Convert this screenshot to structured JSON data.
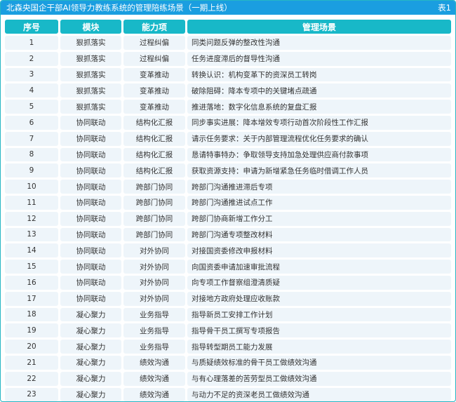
{
  "title": "北森央国企干部AI领导力教练系统的管理陪练场景（一期上线）",
  "table_label": "表1",
  "headers": [
    "序号",
    "模块",
    "能力项",
    "管理场景"
  ],
  "rows": [
    [
      "1",
      "狠抓落实",
      "过程纠偏",
      "同类问题反弹的整改性沟通"
    ],
    [
      "2",
      "狠抓落实",
      "过程纠偏",
      "任务进度滞后的督导性沟通"
    ],
    [
      "3",
      "狠抓落实",
      "变革推动",
      "转换认识：机构变革下的资深员工转岗"
    ],
    [
      "4",
      "狠抓落实",
      "变革推动",
      "破除阻碍：降本专项中的关键堵点疏通"
    ],
    [
      "5",
      "狠抓落实",
      "变革推动",
      "推进落地：数字化信息系统的复盘汇报"
    ],
    [
      "6",
      "协同联动",
      "结构化汇报",
      "同步事实进展：降本增效专项行动首次阶段性工作汇报"
    ],
    [
      "7",
      "协同联动",
      "结构化汇报",
      "请示任务要求：关于内部管理流程优化任务要求的确认"
    ],
    [
      "8",
      "协同联动",
      "结构化汇报",
      "恳请特事特办：争取领导支持加急处理供应商付款事项"
    ],
    [
      "9",
      "协同联动",
      "结构化汇报",
      "获取资源支持：申请为新增紧急任务临时借调工作人员"
    ],
    [
      "10",
      "协同联动",
      "跨部门协同",
      "跨部门沟通推进滞后专项"
    ],
    [
      "11",
      "协同联动",
      "跨部门协同",
      "跨部门沟通推进试点工作"
    ],
    [
      "12",
      "协同联动",
      "跨部门协同",
      "跨部门协商新增工作分工"
    ],
    [
      "13",
      "协同联动",
      "跨部门协同",
      "跨部门沟通专项整改材料"
    ],
    [
      "14",
      "协同联动",
      "对外协同",
      "对接国资委修改申报材料"
    ],
    [
      "15",
      "协同联动",
      "对外协同",
      "向国资委申请加速审批流程"
    ],
    [
      "16",
      "协同联动",
      "对外协同",
      "向专项工作督察组澄清质疑"
    ],
    [
      "17",
      "协同联动",
      "对外协同",
      "对接地方政府处理应收账款"
    ],
    [
      "18",
      "凝心聚力",
      "业务指导",
      "指导新员工安排工作计划"
    ],
    [
      "19",
      "凝心聚力",
      "业务指导",
      "指导骨干员工撰写专项报告"
    ],
    [
      "20",
      "凝心聚力",
      "业务指导",
      "指导转型期员工能力发展"
    ],
    [
      "21",
      "凝心聚力",
      "绩效沟通",
      "与质疑绩效标准的骨干员工做绩效沟通"
    ],
    [
      "22",
      "凝心聚力",
      "绩效沟通",
      "与有心理落差的苦劳型员工做绩效沟通"
    ],
    [
      "23",
      "凝心聚力",
      "绩效沟通",
      "与动力不足的资深老员工做绩效沟通"
    ]
  ]
}
